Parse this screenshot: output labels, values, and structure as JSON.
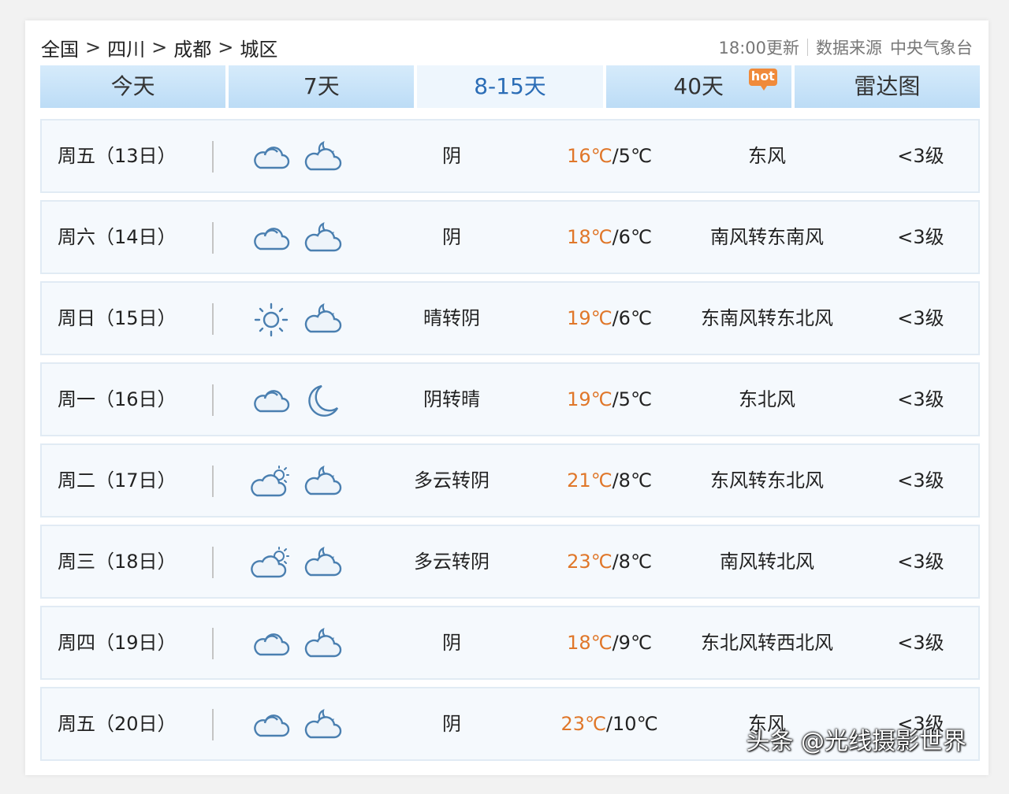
{
  "breadcrumb": [
    "全国",
    "四川",
    "成都",
    "城区"
  ],
  "breadcrumb_sep": ">",
  "meta": {
    "update": "18:00更新",
    "source_label": "数据来源",
    "source_name": "中央气象台"
  },
  "tabs": [
    {
      "label": "今天"
    },
    {
      "label": "7天"
    },
    {
      "label": "8-15天"
    },
    {
      "label": "40天",
      "badge": "hot"
    },
    {
      "label": "雷达图"
    }
  ],
  "rows": [
    {
      "date": "周五（13日）",
      "icon_day": "cloudy-icon",
      "icon_night": "cloudy-night-icon",
      "desc": "阴",
      "high": "16℃",
      "low": "/5℃",
      "wind": "东风",
      "level": "<3级"
    },
    {
      "date": "周六（14日）",
      "icon_day": "cloudy-icon",
      "icon_night": "cloudy-night-icon",
      "desc": "阴",
      "high": "18℃",
      "low": "/6℃",
      "wind": "南风转东南风",
      "level": "<3级"
    },
    {
      "date": "周日（15日）",
      "icon_day": "sunny-icon",
      "icon_night": "cloudy-night-icon",
      "desc": "晴转阴",
      "high": "19℃",
      "low": "/6℃",
      "wind": "东南风转东北风",
      "level": "<3级"
    },
    {
      "date": "周一（16日）",
      "icon_day": "cloudy-icon",
      "icon_night": "moon-icon",
      "desc": "阴转晴",
      "high": "19℃",
      "low": "/5℃",
      "wind": "东北风",
      "level": "<3级"
    },
    {
      "date": "周二（17日）",
      "icon_day": "partly-cloudy-icon",
      "icon_night": "cloudy-night-icon",
      "desc": "多云转阴",
      "high": "21℃",
      "low": "/8℃",
      "wind": "东风转东北风",
      "level": "<3级"
    },
    {
      "date": "周三（18日）",
      "icon_day": "partly-cloudy-icon",
      "icon_night": "cloudy-night-icon",
      "desc": "多云转阴",
      "high": "23℃",
      "low": "/8℃",
      "wind": "南风转北风",
      "level": "<3级"
    },
    {
      "date": "周四（19日）",
      "icon_day": "cloudy-icon",
      "icon_night": "cloudy-night-icon",
      "desc": "阴",
      "high": "18℃",
      "low": "/9℃",
      "wind": "东北风转西北风",
      "level": "<3级"
    },
    {
      "date": "周五（20日）",
      "icon_day": "cloudy-icon",
      "icon_night": "cloudy-night-icon",
      "desc": "阴",
      "high": "23℃",
      "low": "/10℃",
      "wind": "东风",
      "level": "<3级"
    }
  ],
  "colors": {
    "high_temp": "#e0772a",
    "tab_active": "#2b6db6",
    "icon_stroke": "#4a7fb0"
  },
  "watermark": "头条 @光线摄影世界"
}
